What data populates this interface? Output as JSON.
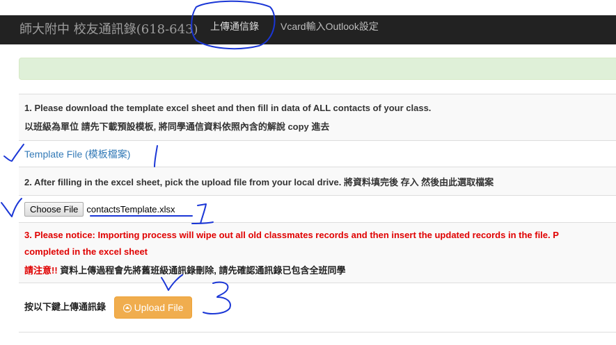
{
  "navbar": {
    "brand": "師大附中 校友通訊錄(618-643)",
    "links": [
      "上傳通信錄",
      "Vcard輸入Outlook設定"
    ]
  },
  "steps": {
    "step1_en": "1. Please download the template excel sheet and then fill in data of ALL contacts of your class.",
    "step1_zh": "以班級為單位 請先下載預設模板, 將同學通信資料依照內含的解說 copy 進去",
    "template_link": "Template File (模板檔案)",
    "step2": "2. After filling in the excel sheet, pick the upload file from your local drive. 將資料填完後 存入 然後由此選取檔案",
    "choose_file_label": "Choose File",
    "chosen_file": "contactsTemplate.xlsx",
    "notice_en": "3. Please notice: Importing process will wipe out all old classmates records and then insert the updated records in the file. P",
    "notice_en_2": "completed in the excel sheet",
    "notice_zh_red": "請注意!!",
    "notice_zh": " 資料上傳過程會先將舊班級通訊錄刪除, 請先確認通訊錄已包含全班同學",
    "upload_prompt": "按以下鍵上傳通訊錄",
    "upload_button": "Upload File"
  },
  "annotations": {
    "checkmarks": 3,
    "numbers": [
      "1",
      "3"
    ],
    "ink_color": "#1a36d6"
  },
  "colors": {
    "navbar": "#222222",
    "success_alert": "#dff0d8",
    "link": "#337ab7",
    "warning": "#e00000",
    "upload_button": "#f0ad4e"
  }
}
